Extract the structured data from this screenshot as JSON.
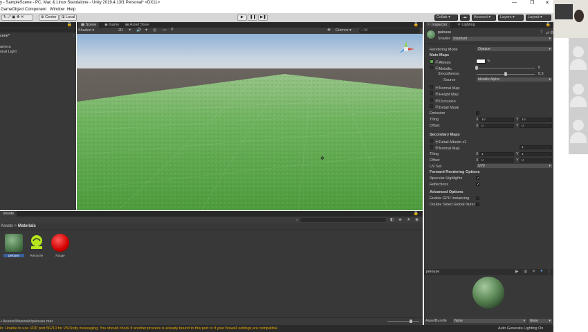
{
  "window": {
    "title": "y - SampleScene - PC, Mac & Linux Standalone - Unity 2019.4.13f1 Personal* <DX11>",
    "minimize": "—",
    "maximize": "❐",
    "close": "✕"
  },
  "menu": [
    "GameObject",
    "Component",
    "Window",
    "Help"
  ],
  "toolbar": {
    "pivot": "Center",
    "space": "Local",
    "play": "▶",
    "pause": "❚❚",
    "step": "▶❚",
    "collab": "Collab ▾",
    "account": "Account ▾",
    "layers": "Layers ▾",
    "layout": "Layout ▾"
  },
  "hierarchy": {
    "scene": "cene*",
    "items": [
      "amera",
      "onal Light"
    ]
  },
  "scene_view": {
    "tabs": [
      "Scene",
      "Game",
      "Asset Store"
    ],
    "shading": "Shaded",
    "mode_2d": "2D",
    "gizmos": "Gizmos ▾",
    "search": "All"
  },
  "project": {
    "console_tab": "onsole",
    "breadcrumb_root": "Assets",
    "breadcrumb_sep": ">",
    "breadcrumb_current": "Materials",
    "assets": [
      {
        "name": "pelouse",
        "kind": "material-green"
      },
      {
        "name": "Relouche",
        "kind": "material-grass-icon"
      },
      {
        "name": "Rouge",
        "kind": "material-red"
      }
    ],
    "footer_path": "Assets/Materials/pelouse.mat"
  },
  "inspector": {
    "tabs": [
      "Inspector",
      "Lighting"
    ],
    "material_name": "pelouse",
    "shader_label": "Shader",
    "shader_value": "Standard",
    "rendering_mode_label": "Rendering Mode",
    "rendering_mode_value": "Opaque",
    "main_maps": "Main Maps",
    "albedo": "Albedo",
    "metallic": "Metallic",
    "metallic_value": "0",
    "smoothness": "Smoothness",
    "smoothness_value": "0.5",
    "source_label": "Source",
    "source_value": "Metallic Alpha",
    "normal_map": "Normal Map",
    "height_map": "Height Map",
    "occlusion": "Occlusion",
    "detail_mask": "Detail Mask",
    "emission": "Emission",
    "tiling_label": "Tiling",
    "offset_label": "Offset",
    "x": "X",
    "y": "Y",
    "main_tiling_x": "10",
    "main_tiling_y": "10",
    "main_offset_x": "0",
    "main_offset_y": "0",
    "secondary_maps": "Secondary Maps",
    "detail_albedo": "Detail Albedo x2",
    "sec_normal_map": "Normal Map",
    "sec_normal_value": "1",
    "sec_tiling_x": "1",
    "sec_tiling_y": "1",
    "sec_offset_x": "0",
    "sec_offset_y": "0",
    "uv_set_label": "UV Set",
    "uv_set_value": "UV0",
    "forward_options": "Forward Rendering Options",
    "specular_highlights": "Specular Highlights",
    "reflections": "Reflections",
    "advanced_options": "Advanced Options",
    "gpu_instancing": "Enable GPU Instancing",
    "double_sided_gi": "Double Sided Global Illumi",
    "preview_name": "pelouse",
    "assetbundle_label": "AssetBundle",
    "assetbundle_value": "None",
    "assetbundle_variant": "None",
    "metallic_level": 0.0,
    "smoothness_level": 0.5
  },
  "status": {
    "message": "lo: Unable to use UDP port 56210 for VS/Unity messaging. You should check if another process is already bound to this port or if your firewall settings are compatible.",
    "right": "Auto Generate Lighting On"
  },
  "colors": {
    "editor_bg": "#383838",
    "grass": "#5aa84a",
    "sky": "#c9d4e0",
    "warning": "#e0a800"
  }
}
